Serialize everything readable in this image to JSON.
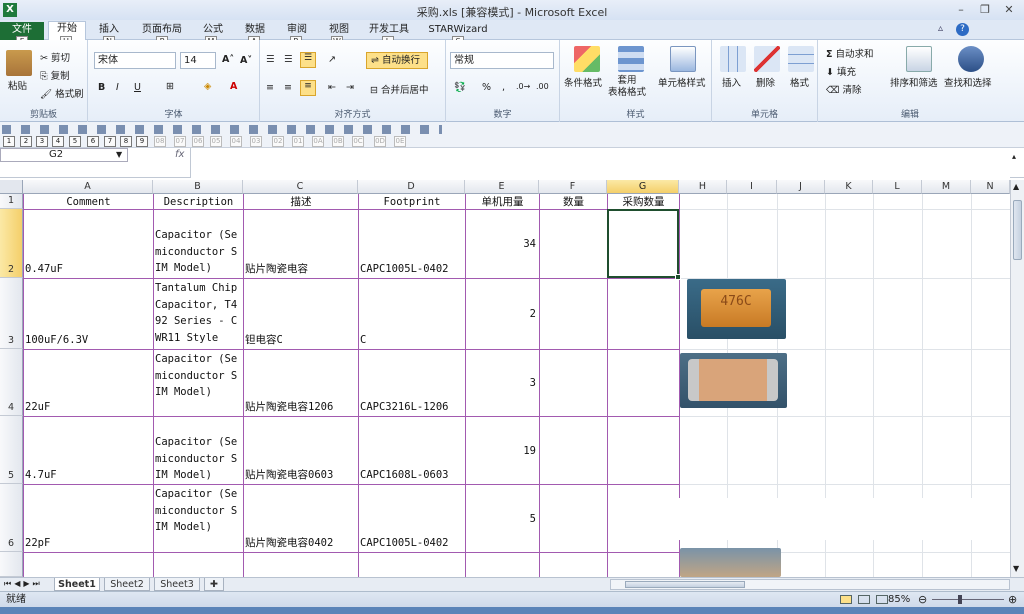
{
  "window": {
    "title": "采购.xls  [兼容模式] - Microsoft Excel"
  },
  "ribbon_tabs": [
    {
      "label": "文件",
      "key": "F"
    },
    {
      "label": "开始",
      "key": "H"
    },
    {
      "label": "插入",
      "key": "N"
    },
    {
      "label": "页面布局",
      "key": "P"
    },
    {
      "label": "公式",
      "key": "M"
    },
    {
      "label": "数据",
      "key": "A"
    },
    {
      "label": "审阅",
      "key": "R"
    },
    {
      "label": "视图",
      "key": "W"
    },
    {
      "label": "开发工具",
      "key": "L"
    },
    {
      "label": "STARWizard",
      "key": "S"
    }
  ],
  "clipboard": {
    "paste": "粘贴",
    "cut": "剪切",
    "copy": "复制",
    "format_painter": "格式刷",
    "group": "剪贴板"
  },
  "font": {
    "name": "宋体",
    "size": "14",
    "group": "字体"
  },
  "alignment": {
    "wrap": "自动换行",
    "merge": "合并后居中",
    "group": "对齐方式"
  },
  "number": {
    "format": "常规",
    "group": "数字"
  },
  "styles": {
    "conditional": "条件格式",
    "table": "套用\n表格格式",
    "cell_styles": "单元格样式",
    "group": "样式"
  },
  "cells": {
    "insert": "插入",
    "delete": "删除",
    "format": "格式",
    "group": "单元格"
  },
  "editing": {
    "autosum": "自动求和",
    "fill": "填充",
    "clear": "清除",
    "sort_filter": "排序和筛选",
    "find_select": "查找和选择",
    "group": "编辑"
  },
  "qat_keys": [
    "1",
    "2",
    "3",
    "4",
    "5",
    "6",
    "7",
    "8",
    "9",
    "08",
    "07",
    "06",
    "05",
    "04",
    "03",
    "02",
    "01",
    "0A",
    "0B",
    "0C",
    "0D",
    "0E"
  ],
  "formula_bar": {
    "name_box": "G2",
    "fx": "fx"
  },
  "columns": [
    "A",
    "B",
    "C",
    "D",
    "E",
    "F",
    "G",
    "H",
    "I",
    "J",
    "K",
    "L",
    "M",
    "N"
  ],
  "rows": [
    "1",
    "2",
    "3",
    "4",
    "5",
    "6"
  ],
  "table": {
    "header": [
      "Comment",
      "Description",
      "描述",
      "Footprint",
      "单机用量",
      "数量",
      "采购数量"
    ],
    "rows": [
      {
        "comment": "0.47uF",
        "description": "Capacitor (Semiconductor SIM Model)",
        "desc_cn": "贴片陶瓷电容",
        "footprint": "CAPC1005L-0402",
        "qty": "34"
      },
      {
        "comment": "100uF/6.3V",
        "description": "Tantalum Chip Capacitor, T492 Series - CWR11 Style",
        "desc_cn": "钽电容C",
        "footprint": "C",
        "qty": "2"
      },
      {
        "comment": "22uF",
        "description": "Capacitor (Semiconductor SIM Model)",
        "desc_cn": "贴片陶瓷电容1206",
        "footprint": "CAPC3216L-1206",
        "qty": "3"
      },
      {
        "comment": "4.7uF",
        "description": "Capacitor (Semiconductor SIM Model)",
        "desc_cn": "贴片陶瓷电容0603",
        "footprint": "CAPC1608L-0603",
        "qty": "19"
      },
      {
        "comment": "22pF",
        "description": "Capacitor (Semiconductor SIM Model)",
        "desc_cn": "贴片陶瓷电容0402",
        "footprint": "CAPC1005L-0402",
        "qty": "5"
      }
    ]
  },
  "photos": [
    {
      "label": "476C"
    },
    {
      "label": ""
    },
    {
      "label": ""
    }
  ],
  "sheets": [
    "Sheet1",
    "Sheet2",
    "Sheet3"
  ],
  "status": {
    "ready": "就绪",
    "zoom": "85%"
  }
}
